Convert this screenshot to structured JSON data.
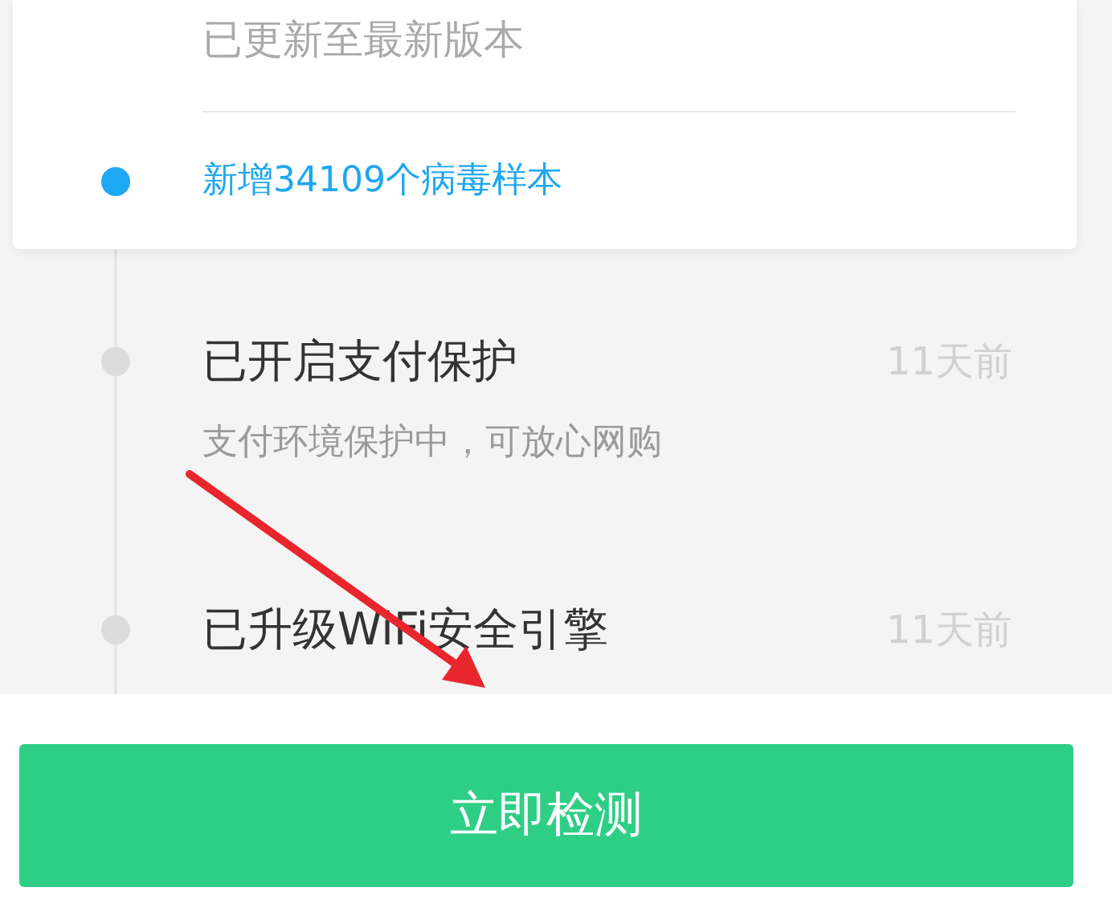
{
  "update_card": {
    "status": "已更新至最新版本",
    "latest": {
      "text": "新增34109个病毒样本",
      "color": "#1ea7f2"
    }
  },
  "events": [
    {
      "title": "已开启支付保护",
      "time": "11天前",
      "detail": "支付环境保护中，可放心网购"
    },
    {
      "title": "已升级WiFi安全引擎",
      "time": "11天前"
    }
  ],
  "button": {
    "label": "立即检测"
  }
}
